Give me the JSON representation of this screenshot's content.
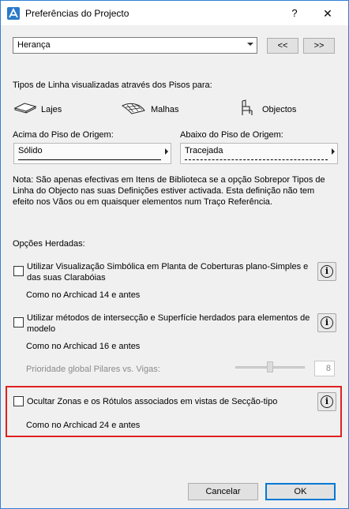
{
  "window": {
    "title": "Preferências do Projecto",
    "help": "?",
    "close": "✕"
  },
  "top_select": {
    "value": "Herança"
  },
  "nav": {
    "prev": "<<",
    "next": ">>"
  },
  "line_types": {
    "heading": "Tipos de Linha visualizadas através dos Pisos para:",
    "slabs": "Lajes",
    "meshes": "Malhas",
    "objects": "Objectos"
  },
  "above": {
    "label": "Acima do Piso de Origem:",
    "value": "Sólido"
  },
  "below": {
    "label": "Abaixo do Piso de Origem:",
    "value": "Tracejada"
  },
  "note": "Nota: São apenas efectivas em Itens de Biblioteca se a opção Sobrepor Tipos de Linha do Objecto nas suas Definições estiver activada. Esta definição não tem efeito nos Vãos ou em quaisquer elementos num Traço Referência.",
  "inherited": {
    "heading": "Opções Herdadas:",
    "options": [
      {
        "label": "Utilizar Visualização Simbólica em Planta de Coberturas plano-Simples e das suas Clarabóias",
        "sub": "Como no Archicad 14 e antes",
        "checked": false
      },
      {
        "label": "Utilizar métodos de intersecção e Superfície herdados para elementos de modelo",
        "sub": "Como no Archicad 16 e antes",
        "checked": false
      },
      {
        "label": "Ocultar Zonas e os Rótulos associados em vistas de Secção-tipo",
        "sub": "Como no Archicad 24 e antes",
        "checked": false
      }
    ],
    "priority_label": "Prioridade global Pilares vs. Vigas:",
    "priority_value": "8"
  },
  "footer": {
    "cancel": "Cancelar",
    "ok": "OK"
  },
  "colors": {
    "accent": "#0078d7",
    "highlight": "#e02020",
    "title_icon": "#2a7ac9"
  }
}
